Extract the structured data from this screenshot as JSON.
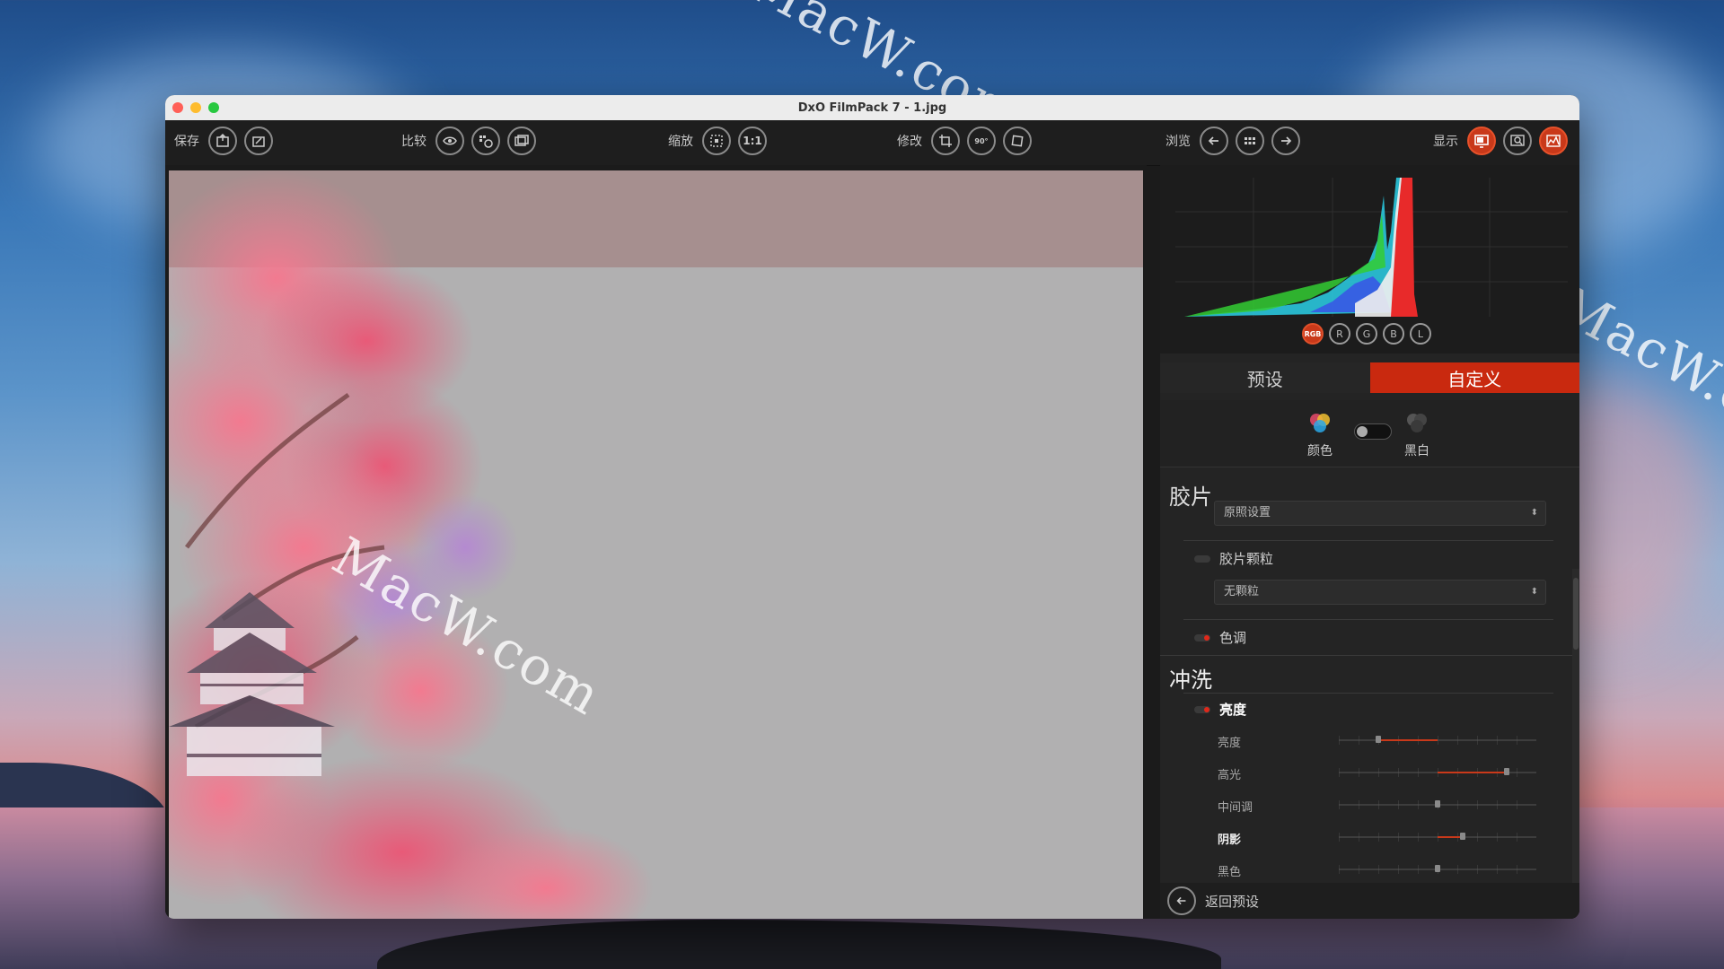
{
  "window": {
    "title": "DxO FilmPack 7 - 1.jpg"
  },
  "watermark": {
    "text": "MacW.com"
  },
  "toolbar": {
    "save_label": "保存",
    "compare_label": "比较",
    "zoom_label": "缩放",
    "zoom_1to1": "1:1",
    "edit_label": "修改",
    "rotate_label": "90°",
    "browse_label": "浏览",
    "display_label": "显示"
  },
  "histogram": {
    "channels": [
      "RGB",
      "R",
      "G",
      "B",
      "L"
    ],
    "active_channel": "RGB"
  },
  "tabs": [
    {
      "label": "预设",
      "active": false
    },
    {
      "label": "自定义",
      "active": true
    }
  ],
  "mode": {
    "color_label": "颜色",
    "bw_label": "黑白",
    "toggle_on": false
  },
  "film": {
    "title": "胶片",
    "film_select": "原照设置",
    "grain_label": "胶片颗粒",
    "grain_select": "无颗粒",
    "tone_label": "色调"
  },
  "develop": {
    "title": "冲洗",
    "brightness_group": "亮度",
    "sliders": [
      {
        "label": "亮度",
        "bold": false,
        "value": -0.6
      },
      {
        "label": "高光",
        "bold": false,
        "value": 0.7
      },
      {
        "label": "中间调",
        "bold": false,
        "value": 0.0
      },
      {
        "label": "阴影",
        "bold": true,
        "value": 0.25
      },
      {
        "label": "黑色",
        "bold": false,
        "value": 0.0
      }
    ]
  },
  "footer": {
    "back_label": "返回预设"
  },
  "colors": {
    "accent": "#c9291f",
    "panel": "#242424",
    "toolbar": "#1e1e1e"
  }
}
